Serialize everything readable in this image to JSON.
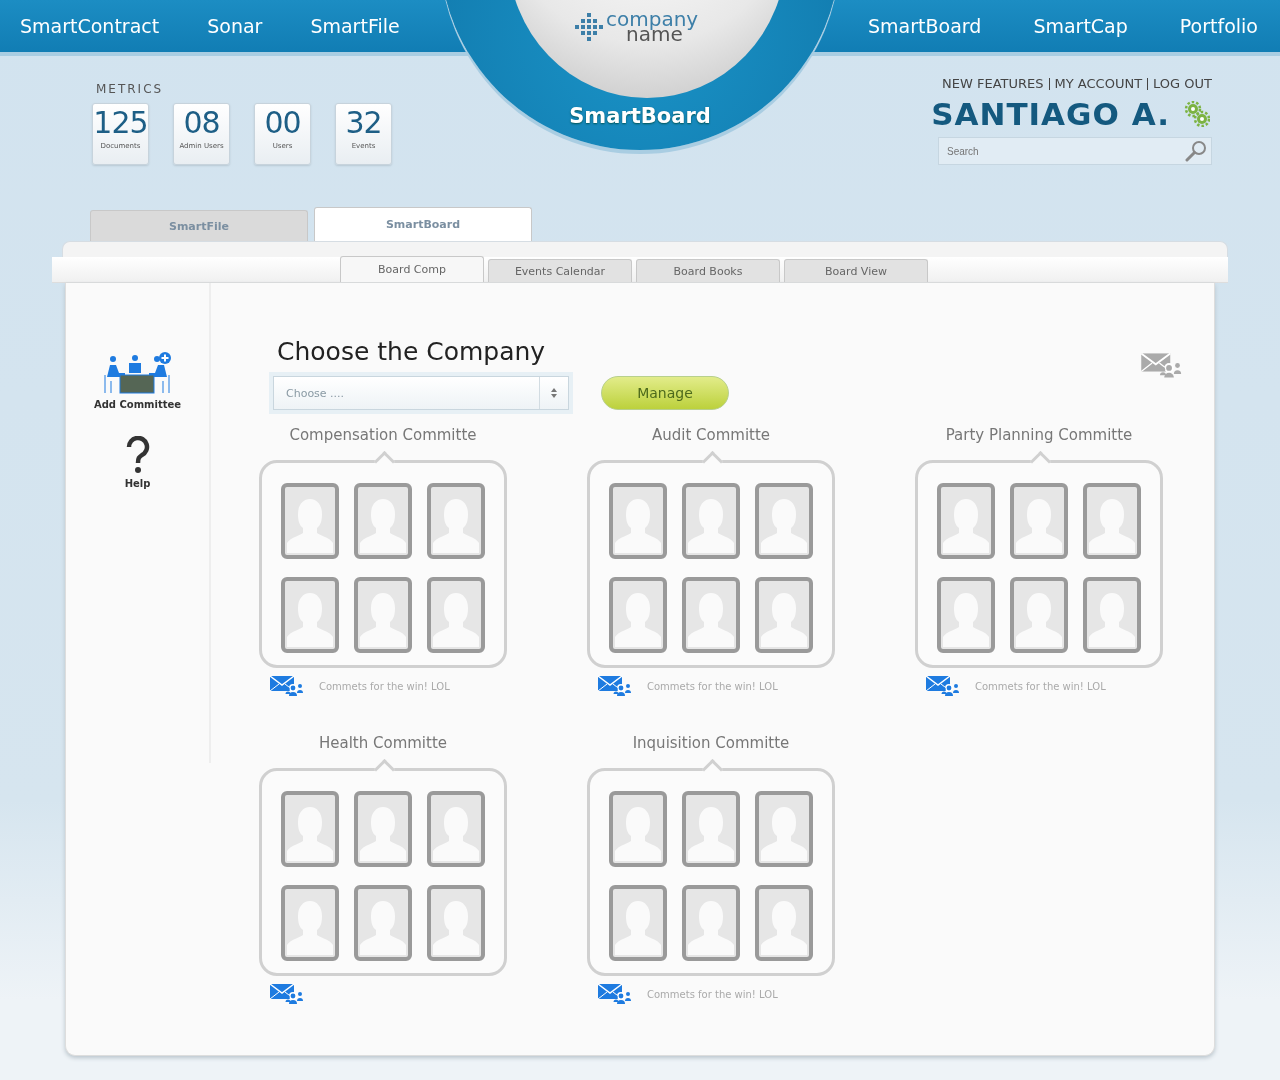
{
  "nav": {
    "left": [
      "SmartContract",
      "Sonar",
      "SmartFile"
    ],
    "right": [
      "SmartBoard",
      "SmartCap",
      "Portfolio"
    ]
  },
  "logo": {
    "line1": "company",
    "line2": "name"
  },
  "current_app": "SmartBoard",
  "metrics": {
    "title": "METRICS",
    "items": [
      {
        "value": "125",
        "label": "Documents"
      },
      {
        "value": "08",
        "label": "Admin Users"
      },
      {
        "value": "00",
        "label": "Users"
      },
      {
        "value": "32",
        "label": "Events"
      }
    ]
  },
  "account": {
    "links": [
      "NEW FEATURES",
      "MY ACCOUNT",
      "LOG OUT"
    ],
    "user": "SANTIAGO A.",
    "search": {
      "placeholder": "Search"
    }
  },
  "app_tabs": [
    {
      "label": "SmartFile",
      "selected": false
    },
    {
      "label": "SmartBoard",
      "selected": true
    }
  ],
  "sub_tabs": [
    {
      "label": "Board Comp",
      "selected": true
    },
    {
      "label": "Events Calendar",
      "selected": false
    },
    {
      "label": "Board Books",
      "selected": false
    },
    {
      "label": "Board View",
      "selected": false
    }
  ],
  "sidebar": [
    {
      "kind": "add",
      "label": "Add Committee"
    },
    {
      "kind": "help",
      "label": "Help"
    }
  ],
  "main": {
    "title": "Choose the Company",
    "select": {
      "placeholder": "Choose ...."
    },
    "button": "Manage"
  },
  "committees": [
    {
      "name": "Compensation Committe",
      "comment": "Commets for the win! LOL"
    },
    {
      "name": "Audit Committe",
      "comment": "Commets for the win! LOL"
    },
    {
      "name": "Party Planning Committe",
      "comment": "Commets for the win! LOL"
    },
    {
      "name": "Health Committe"
    },
    {
      "name": "Inquisition Committe",
      "comment": "Commets for the win! LOL"
    }
  ]
}
